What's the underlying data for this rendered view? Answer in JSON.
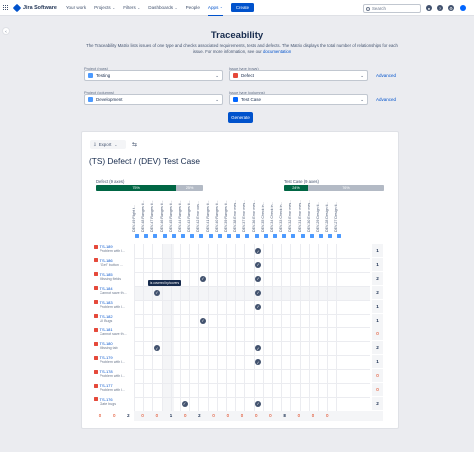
{
  "nav": {
    "logo": "Jira Software",
    "items": [
      {
        "label": "Your work",
        "dropdown": false
      },
      {
        "label": "Projects",
        "dropdown": true
      },
      {
        "label": "Filters",
        "dropdown": true
      },
      {
        "label": "Dashboards",
        "dropdown": true
      },
      {
        "label": "People",
        "dropdown": false
      },
      {
        "label": "Apps",
        "dropdown": true,
        "active": true
      }
    ],
    "create": "Create",
    "search_placeholder": "Search"
  },
  "header": {
    "title": "Traceability",
    "subtitle_1": "The Traceability Matrix lists issues of one type and checks associated requirements, tests and defects. The Matrix displays the total number of relationships for each issue. For more information, see our",
    "subtitle_link": "documentation"
  },
  "form": {
    "project_rows_label": "Project (rows)",
    "project_rows_value": "Testing",
    "issue_type_rows_label": "Issue type (rows)",
    "issue_type_rows_value": "Defect",
    "project_cols_label": "Project (columns)",
    "project_cols_value": "Development",
    "issue_type_cols_label": "Issue type (columns)",
    "issue_type_cols_value": "Test Case",
    "advanced": "Advanced",
    "generate": "Generate"
  },
  "matrix": {
    "export": "Export",
    "title": "(TS) Defect / (DEV) Test Case",
    "defect_label": "Defect (9 axes)",
    "defect_covered": "75%",
    "defect_rest": "25%",
    "defect_fraction": 0.75,
    "testcase_label": "Test Case (9 axes)",
    "testcase_covered": "24%",
    "testcase_rest": "76%",
    "testcase_fraction": 0.24,
    "tooltip": "is covered by/covers",
    "columns": [
      "DEV-49 Flight t...",
      "DEV-48 Ranges ti...",
      "DEV-47 Ranges ti...",
      "DEV-46 Ranges ti...",
      "DEV-45 Ranges ti...",
      "DEV-44 Ranges ti...",
      "DEV-43 Ranges ti...",
      "DEV-42 Error cos...",
      "DEV-41 Ranges ti...",
      "DEV-40 Ranges ti...",
      "DEV-39 Ranges ti...",
      "DEV-38 Error mes...",
      "DEV-37 Error mes...",
      "DEV-36 Error mes...",
      "DEV-35 Check in...",
      "DEV-34 Check in...",
      "DEV-33 Check in...",
      "DEV-32 Error mes...",
      "DEV-31 Error mes...",
      "DEV-30 Error mes...",
      "DEV-29 Design ti...",
      "DEV-28 Design ti...",
      "DEV-27 Design ti..."
    ],
    "rows": [
      {
        "key": "TS-189",
        "desc": "Problem with I...",
        "checks": [
          13
        ],
        "total": "1"
      },
      {
        "key": "TS-186",
        "desc": "\"Get\" button ...",
        "checks": [
          13
        ],
        "total": "1"
      },
      {
        "key": "TS-185",
        "desc": "Missing fields",
        "checks": [
          7,
          13
        ],
        "total": "2"
      },
      {
        "key": "TS-184",
        "desc": "Cannot save th...",
        "checks": [
          2,
          13
        ],
        "total": "2"
      },
      {
        "key": "TS-183",
        "desc": "Problem with I...",
        "checks": [
          13
        ],
        "total": "1"
      },
      {
        "key": "TS-182",
        "desc": "UI Bugs",
        "checks": [
          7
        ],
        "total": "1"
      },
      {
        "key": "TS-181",
        "desc": "Cannot save th...",
        "checks": [],
        "total": "0"
      },
      {
        "key": "TS-180",
        "desc": "Missing tab",
        "checks": [
          2,
          13
        ],
        "total": "2"
      },
      {
        "key": "TS-179",
        "desc": "Problem with I...",
        "checks": [
          13
        ],
        "total": "1"
      },
      {
        "key": "TS-178",
        "desc": "Problem with I...",
        "checks": [],
        "total": "0"
      },
      {
        "key": "TS-177",
        "desc": "Problem with I...",
        "checks": [],
        "total": "0"
      },
      {
        "key": "TS-176",
        "desc": "Gate bugs",
        "checks": [
          5,
          13
        ],
        "total": "2"
      }
    ],
    "column_totals": [
      "0",
      "0",
      "2",
      "0",
      "0",
      "1",
      "0",
      "2",
      "0",
      "0",
      "0",
      "0",
      "0",
      "8",
      "0",
      "0",
      "0"
    ]
  }
}
